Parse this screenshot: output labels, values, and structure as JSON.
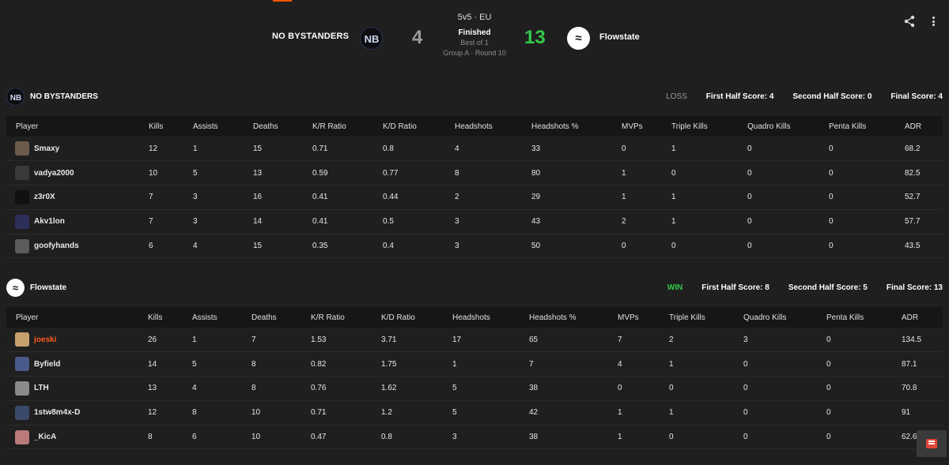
{
  "match": {
    "format": "5v5 · EU",
    "status": "Finished",
    "best_of": "Best of 1",
    "group_round": "Group A · Round 10",
    "left_team": "NO BYSTANDERS",
    "left_score": "4",
    "right_team": "Flowstate",
    "right_score": "13",
    "left_logo_text": "NB",
    "right_logo_text": "≈"
  },
  "columns": [
    "Player",
    "Kills",
    "Assists",
    "Deaths",
    "K/R Ratio",
    "K/D Ratio",
    "Headshots",
    "Headshots %",
    "MVPs",
    "Triple Kills",
    "Quadro Kills",
    "Penta Kills",
    "ADR"
  ],
  "teams": [
    {
      "name": "NO BYSTANDERS",
      "result": "LOSS",
      "first_half": "First Half Score: 4",
      "second_half": "Second Half Score: 0",
      "final": "Final Score: 4",
      "players": [
        {
          "name": "Smaxy",
          "avatar_color": "#6b5b4b",
          "stats": [
            "12",
            "1",
            "15",
            "0.71",
            "0.8",
            "4",
            "33",
            "0",
            "1",
            "0",
            "0",
            "68.2"
          ]
        },
        {
          "name": "vadya2000",
          "avatar_color": "#3a3a3a",
          "stats": [
            "10",
            "5",
            "13",
            "0.59",
            "0.77",
            "8",
            "80",
            "1",
            "0",
            "0",
            "0",
            "82.5"
          ]
        },
        {
          "name": "z3r0X",
          "avatar_color": "#111111",
          "stats": [
            "7",
            "3",
            "16",
            "0.41",
            "0.44",
            "2",
            "29",
            "1",
            "1",
            "0",
            "0",
            "52.7"
          ]
        },
        {
          "name": "Akv1lon",
          "avatar_color": "#2c2f5a",
          "stats": [
            "7",
            "3",
            "14",
            "0.41",
            "0.5",
            "3",
            "43",
            "2",
            "1",
            "0",
            "0",
            "57.7"
          ]
        },
        {
          "name": "goofyhands",
          "avatar_color": "#5c5c5c",
          "stats": [
            "6",
            "4",
            "15",
            "0.35",
            "0.4",
            "3",
            "50",
            "0",
            "0",
            "0",
            "0",
            "43.5"
          ]
        }
      ]
    },
    {
      "name": "Flowstate",
      "result": "WIN",
      "first_half": "First Half Score: 8",
      "second_half": "Second Half Score: 5",
      "final": "Final Score: 13",
      "players": [
        {
          "name": "joeski",
          "avatar_color": "#c8a070",
          "highlight": true,
          "stats": [
            "26",
            "1",
            "7",
            "1.53",
            "3.71",
            "17",
            "65",
            "7",
            "2",
            "3",
            "0",
            "134.5"
          ]
        },
        {
          "name": "Byfield",
          "avatar_color": "#4a5a8a",
          "stats": [
            "14",
            "5",
            "8",
            "0.82",
            "1.75",
            "1",
            "7",
            "4",
            "1",
            "0",
            "0",
            "87.1"
          ]
        },
        {
          "name": "LTH",
          "avatar_color": "#8a8a8a",
          "stats": [
            "13",
            "4",
            "8",
            "0.76",
            "1.62",
            "5",
            "38",
            "0",
            "0",
            "0",
            "0",
            "70.8"
          ]
        },
        {
          "name": "1stw8m4x-D",
          "avatar_color": "#3b4a6b",
          "stats": [
            "12",
            "8",
            "10",
            "0.71",
            "1.2",
            "5",
            "42",
            "1",
            "1",
            "0",
            "0",
            "91"
          ]
        },
        {
          "name": "_KicA",
          "avatar_color": "#b87a7a",
          "stats": [
            "8",
            "6",
            "10",
            "0.47",
            "0.8",
            "3",
            "38",
            "1",
            "0",
            "0",
            "0",
            "62.6"
          ]
        }
      ]
    }
  ],
  "icons": {
    "share": "share-icon",
    "more": "more-vertical-icon",
    "chat": "chat-icon"
  },
  "colors": {
    "accent": "#ff5500",
    "win": "#35c94a",
    "loss": "#9a9a9a"
  }
}
